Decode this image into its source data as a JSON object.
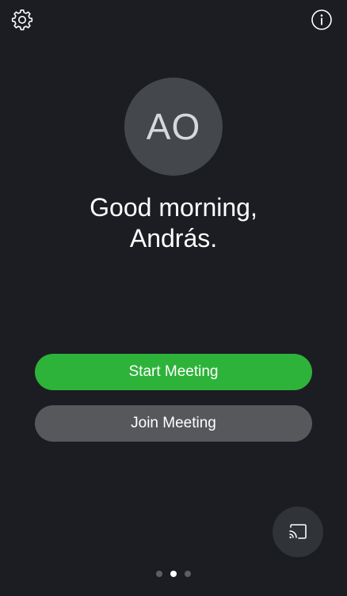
{
  "header": {
    "settings_icon": "gear-icon",
    "info_icon": "info-icon"
  },
  "profile": {
    "initials": "AO"
  },
  "greeting": {
    "line1": "Good morning,",
    "line2": "András."
  },
  "actions": {
    "start_label": "Start Meeting",
    "join_label": "Join Meeting"
  },
  "share": {
    "icon": "screen-share-icon"
  },
  "pager": {
    "count": 3,
    "active_index": 1
  },
  "colors": {
    "background": "#1b1d23",
    "start_button": "#2eb33a",
    "join_button": "#56585c",
    "avatar": "#44474b"
  }
}
